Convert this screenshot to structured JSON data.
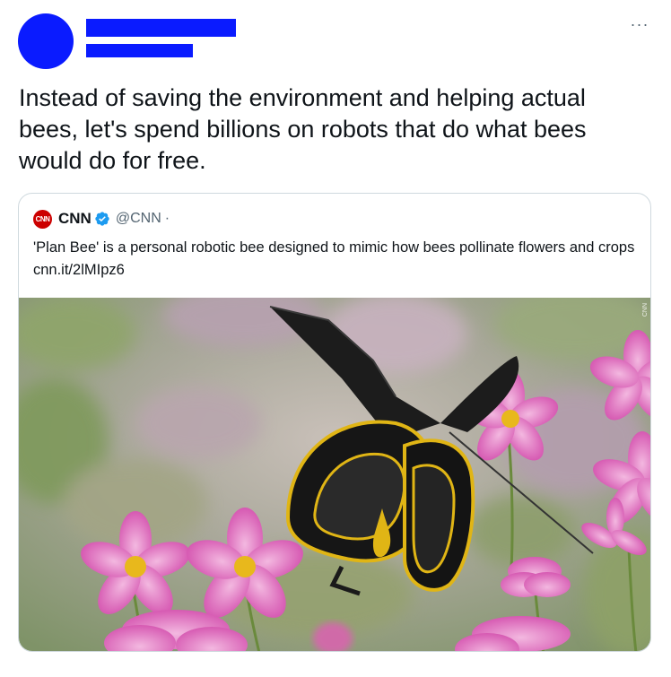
{
  "tweet": {
    "text": "Instead of saving the environment and helping actual bees, let's spend billions on robots that do what bees would do for free.",
    "more_icon": "more-horizontal-icon",
    "more_glyph": "···"
  },
  "quote": {
    "logo_text": "CNN",
    "name": "CNN",
    "handle": "@CNN",
    "separator": "·",
    "verified_icon": "verified-badge-icon",
    "text": "'Plan Bee' is a personal robotic bee designed to mimic how bees pollinate flowers and crops cnn.it/2lMIpz6",
    "image_credit": "CNN",
    "image_subject": "Robotic bee among pink cosmos flowers"
  },
  "colors": {
    "redaction": "#0a1bff",
    "verified": "#1d9bf0",
    "cnn_red": "#cc0000",
    "secondary_text": "#536471",
    "border": "#cfd9de"
  }
}
